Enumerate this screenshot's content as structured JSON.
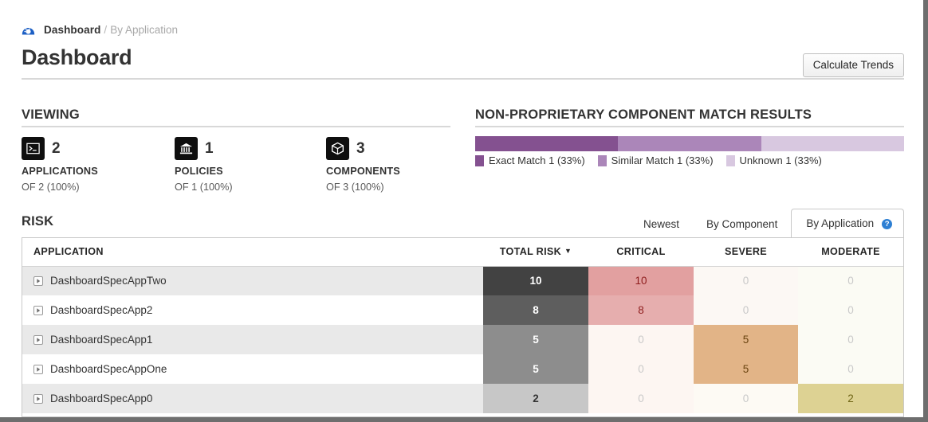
{
  "breadcrumb": {
    "icon": "gauge-icon",
    "current": "Dashboard",
    "separator": "/",
    "tail": "By Application"
  },
  "header": {
    "title": "Dashboard",
    "calculate_trends_label": "Calculate Trends"
  },
  "viewing": {
    "section_title": "VIEWING",
    "stats": [
      {
        "icon": "terminal-icon",
        "value": "2",
        "label": "APPLICATIONS",
        "sub": "OF 2 (100%)"
      },
      {
        "icon": "bank-icon",
        "value": "1",
        "label": "POLICIES",
        "sub": "OF 1 (100%)"
      },
      {
        "icon": "cube-icon",
        "value": "3",
        "label": "COMPONENTS",
        "sub": "OF 3 (100%)"
      }
    ]
  },
  "match_results": {
    "section_title": "NON-PROPRIETARY COMPONENT MATCH RESULTS",
    "segments": [
      {
        "label": "Exact Match 1 (33%)",
        "percent": 33.34,
        "color": "#845190"
      },
      {
        "label": "Similar Match 1 (33%)",
        "percent": 33.33,
        "color": "#ab86b9"
      },
      {
        "label": "Unknown 1 (33%)",
        "percent": 33.33,
        "color": "#d8c8e0"
      }
    ]
  },
  "risk": {
    "section_title": "RISK",
    "tabs": [
      {
        "label": "Newest",
        "active": false
      },
      {
        "label": "By Component",
        "active": false
      },
      {
        "label": "By Application",
        "active": true,
        "help": "?"
      }
    ],
    "columns": [
      "APPLICATION",
      "TOTAL RISK",
      "CRITICAL",
      "SEVERE",
      "MODERATE"
    ],
    "sorted_by": "TOTAL RISK",
    "sort_direction": "desc",
    "sort_caret": "▼",
    "rows": [
      {
        "application": "DashboardSpecAppTwo",
        "total_risk": "10",
        "critical": "10",
        "severe": "0",
        "moderate": "0",
        "total_bg": "#424242",
        "total_fg": "#ffffff",
        "critical_bg": "#e2a0a0",
        "critical_fg": "#8e1d1d",
        "severe_bg": "#fcf8f4",
        "severe_fg": "#c9c9c9",
        "moderate_bg": "#fbfbf4",
        "moderate_fg": "#c9c9c9",
        "row_bg": "#e9e9e9"
      },
      {
        "application": "DashboardSpecApp2",
        "total_risk": "8",
        "critical": "8",
        "severe": "0",
        "moderate": "0",
        "total_bg": "#5e5e5e",
        "total_fg": "#ffffff",
        "critical_bg": "#e6aeae",
        "critical_fg": "#8e1d1d",
        "severe_bg": "#fcf8f4",
        "severe_fg": "#c9c9c9",
        "moderate_bg": "#fbfbf4",
        "moderate_fg": "#c9c9c9",
        "row_bg": "#ffffff"
      },
      {
        "application": "DashboardSpecApp1",
        "total_risk": "5",
        "critical": "0",
        "severe": "5",
        "moderate": "0",
        "total_bg": "#8d8d8d",
        "total_fg": "#ffffff",
        "critical_bg": "#fdf6f2",
        "critical_fg": "#c9c9c9",
        "severe_bg": "#e2b487",
        "severe_fg": "#6b4410",
        "moderate_bg": "#fbfbf4",
        "moderate_fg": "#c9c9c9",
        "row_bg": "#e9e9e9"
      },
      {
        "application": "DashboardSpecAppOne",
        "total_risk": "5",
        "critical": "0",
        "severe": "5",
        "moderate": "0",
        "total_bg": "#8d8d8d",
        "total_fg": "#ffffff",
        "critical_bg": "#fdf6f2",
        "critical_fg": "#c9c9c9",
        "severe_bg": "#e2b487",
        "severe_fg": "#6b4410",
        "moderate_bg": "#fbfbf4",
        "moderate_fg": "#c9c9c9",
        "row_bg": "#ffffff"
      },
      {
        "application": "DashboardSpecApp0",
        "total_risk": "2",
        "critical": "0",
        "severe": "0",
        "moderate": "2",
        "total_bg": "#c7c7c7",
        "total_fg": "#333333",
        "critical_bg": "#fdf6f2",
        "critical_fg": "#c9c9c9",
        "severe_bg": "#fdfaf4",
        "severe_fg": "#c9c9c9",
        "moderate_bg": "#ddd293",
        "moderate_fg": "#6e6414",
        "row_bg": "#e9e9e9"
      }
    ]
  }
}
